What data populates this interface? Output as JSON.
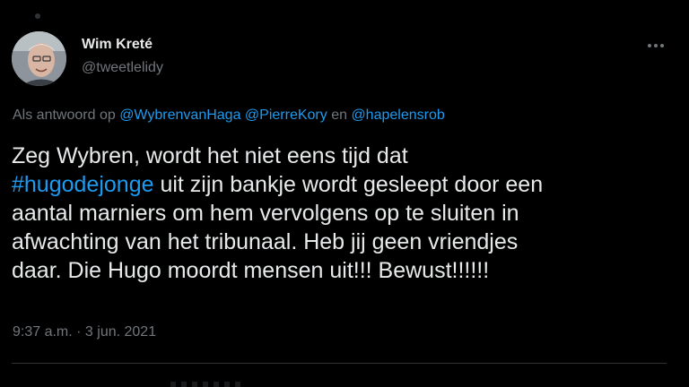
{
  "author": {
    "display_name": "Wim Kreté",
    "handle": "@tweetlelidy"
  },
  "reply_context": {
    "prefix": "Als antwoord op ",
    "mentions": [
      "@WybrenvanHaga",
      "@PierreKory"
    ],
    "conjunction": " en ",
    "last_mention": "@hapelensrob"
  },
  "tweet": {
    "line1": "Zeg Wybren, wordt het niet eens tijd dat",
    "hashtag": "#hugodejonge",
    "line2_rest": " uit zijn bankje wordt gesleept door een",
    "line3": "aantal marniers om hem vervolgens op te sluiten in",
    "line4": "afwachting van het tribunaal. Heb jij geen vriendjes",
    "line5": "daar. Die Hugo moordt mensen uit!!! Bewust!!!!!!"
  },
  "meta": {
    "time": "9:37 a.m.",
    "separator": " · ",
    "date": "3 jun. 2021"
  },
  "colors": {
    "background": "#000000",
    "text_primary": "#e7e9ea",
    "text_secondary": "#71767b",
    "link": "#1d9bf0",
    "divider": "#2f3336"
  },
  "icons": {
    "more": "more-horizontal-icon"
  }
}
